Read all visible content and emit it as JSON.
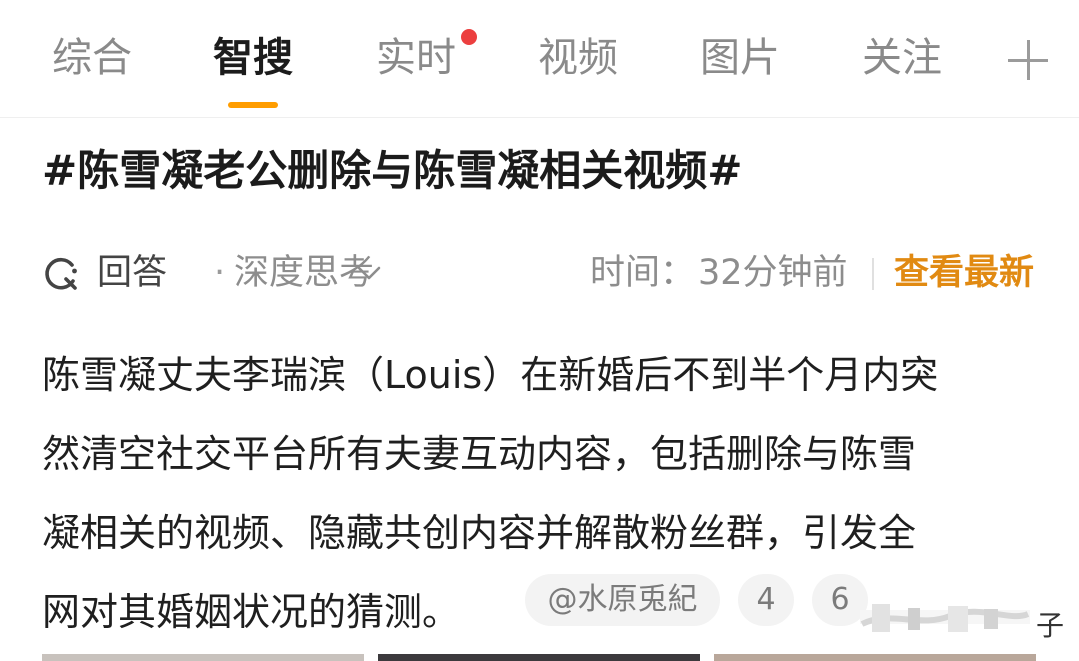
{
  "tabs": {
    "items": [
      {
        "label": "综合",
        "active": false
      },
      {
        "label": "智搜",
        "active": true
      },
      {
        "label": "实时",
        "active": false,
        "has_red_dot": true
      },
      {
        "label": "视频",
        "active": false
      },
      {
        "label": "图片",
        "active": false
      },
      {
        "label": "关注",
        "active": false
      }
    ],
    "more_icon": "plus-icon",
    "accent_color": "#ff9d00"
  },
  "topic": {
    "title": "#陈雪凝老公删除与陈雪凝相关视频#"
  },
  "meta": {
    "icon": "q-search-icon",
    "answer_label": "回答",
    "dot": "·",
    "mode_label": "深度思考",
    "time_label": "时间：",
    "time_value": "32分钟前",
    "latest_label": "查看最新",
    "latest_color": "#e18a12"
  },
  "answer": {
    "lines": [
      "陈雪凝丈夫李瑞滨（Louis）在新婚后不到半个月内突",
      "然清空社交平台所有夫妻互动内容，包括删除与陈雪",
      "凝相关的视频、隐藏共创内容并解散粉丝群，引发全",
      "网对其婚姻状况的猜测。"
    ],
    "source_chip": "@水原兎紀",
    "ref_chips": [
      "4",
      "6"
    ]
  },
  "overlay": {
    "partial_char": "子"
  }
}
